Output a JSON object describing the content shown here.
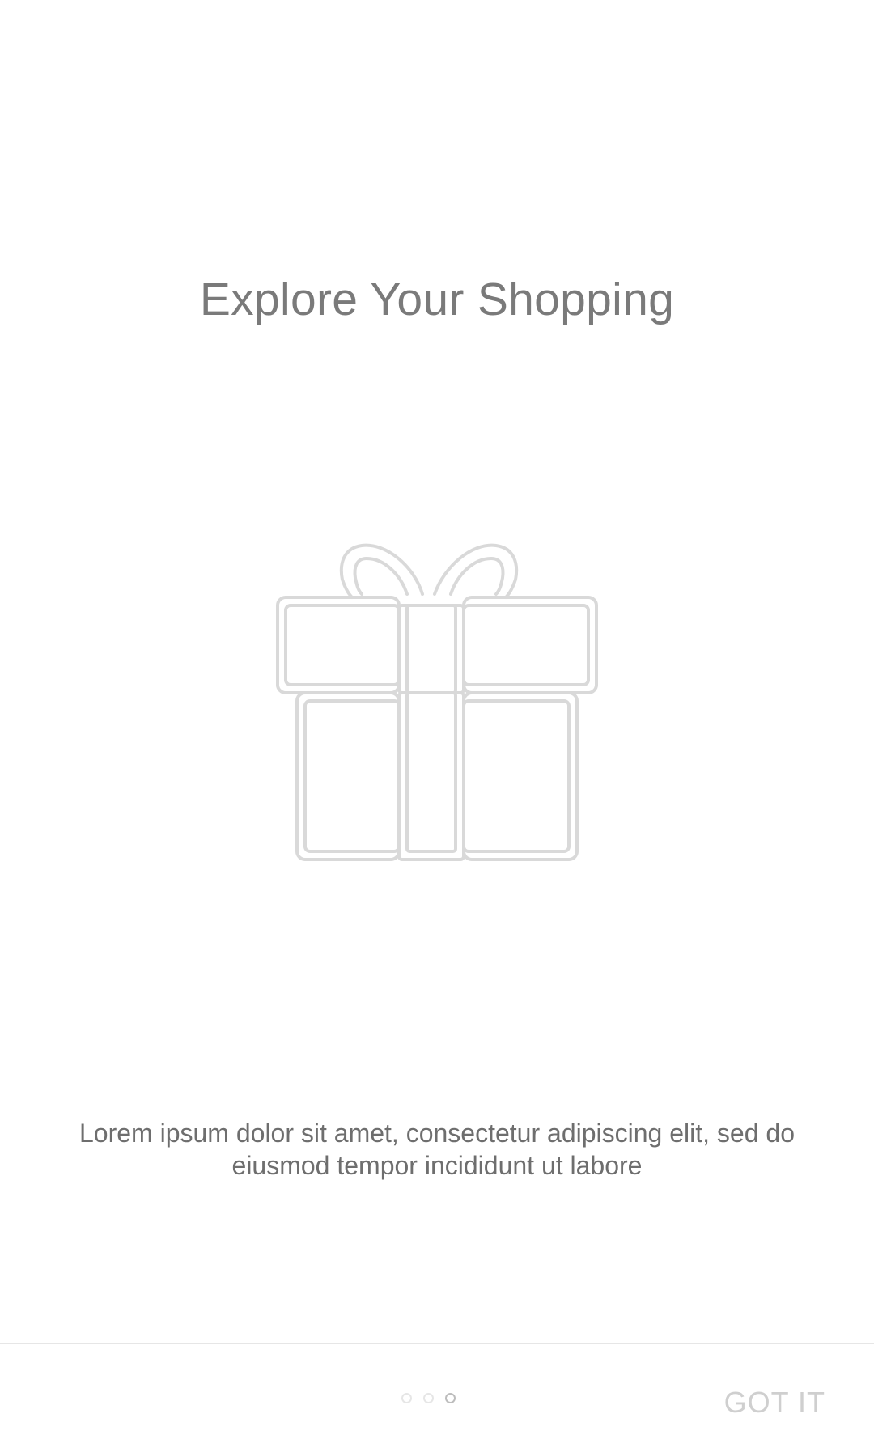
{
  "onboarding": {
    "title": "Explore Your Shopping",
    "illustration_icon": "gift-icon",
    "description": "Lorem ipsum dolor sit amet, consectetur adipiscing elit, sed do eiusmod tempor incididunt ut labore",
    "pager": {
      "page_count": 3,
      "current_page": 3
    },
    "got_it_label": "GOT IT"
  },
  "colors": {
    "background": "#ffffff",
    "title_text": "#7a7a7a",
    "body_text": "#6e6e6e",
    "icon_stroke": "#d9d9d9",
    "button_text": "#cfcfcf",
    "divider": "#e6e6e6"
  }
}
